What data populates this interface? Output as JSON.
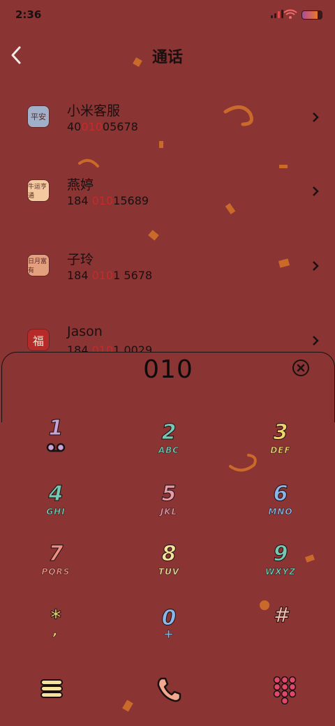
{
  "status": {
    "time": "2:36"
  },
  "header": {
    "title": "通话"
  },
  "contacts": [
    {
      "name": "小米客服",
      "num_pre": "40",
      "num_hl": "010",
      "num_post": "05678",
      "avatar_text": "平安",
      "avatar_bg": "#9fb0c8"
    },
    {
      "name": "燕婷",
      "num_pre": "184 ",
      "num_hl": "010",
      "num_post": "15689",
      "avatar_text": "牛运亨通",
      "avatar_bg": "#f3c9a0"
    },
    {
      "name": "子玲",
      "num_pre": "184 ",
      "num_hl": "010",
      "num_post": "1 5678",
      "avatar_text": "日月富有",
      "avatar_bg": "#e39f7e"
    },
    {
      "name": "Jason",
      "num_pre": "184 ",
      "num_hl": "010",
      "num_post": "1 0029",
      "avatar_text": "福",
      "avatar_bg": "#b72a2a"
    }
  ],
  "dialer": {
    "number": "010"
  },
  "keypad": [
    {
      "digit": "1",
      "letters": "",
      "color": "#c9a3d8"
    },
    {
      "digit": "2",
      "letters": "ABC",
      "color": "#74c9b4"
    },
    {
      "digit": "3",
      "letters": "DEF",
      "color": "#f2d46c"
    },
    {
      "digit": "4",
      "letters": "GHI",
      "color": "#74c9b4"
    },
    {
      "digit": "5",
      "letters": "JKL",
      "color": "#e79aa8"
    },
    {
      "digit": "6",
      "letters": "MNO",
      "color": "#8ab6e8"
    },
    {
      "digit": "7",
      "letters": "PQRS",
      "color": "#ef8f82"
    },
    {
      "digit": "8",
      "letters": "TUV",
      "color": "#f2e29a"
    },
    {
      "digit": "9",
      "letters": "WXYZ",
      "color": "#74c9b4"
    },
    {
      "digit": "*",
      "letters": ",",
      "color": "#f2d46c"
    },
    {
      "digit": "0",
      "letters": "+",
      "color": "#8ab6e8"
    },
    {
      "digit": "#",
      "letters": "",
      "color": "#efb8a8"
    }
  ],
  "bottom": {
    "menu_icon": "menu-icon",
    "call_icon": "phone-icon",
    "keypad_icon": "keypad-icon"
  }
}
